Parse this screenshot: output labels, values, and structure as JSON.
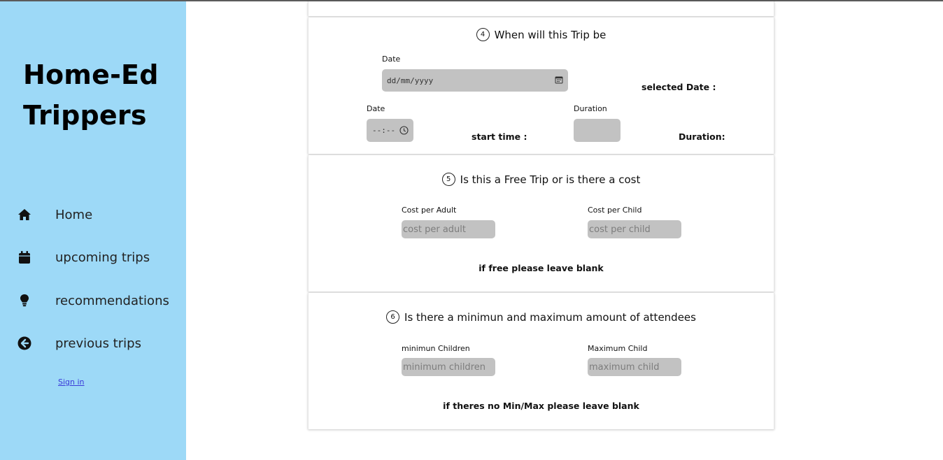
{
  "app": {
    "title_line1": "Home-Ed",
    "title_line2": "Trippers"
  },
  "sidebar": {
    "items": [
      {
        "label": "Home",
        "icon": "home-icon"
      },
      {
        "label": "upcoming trips",
        "icon": "calendar-icon"
      },
      {
        "label": "recommendations",
        "icon": "lightbulb-icon"
      },
      {
        "label": "previous trips",
        "icon": "arrow-left-circle-icon"
      }
    ],
    "signin": "Sign in"
  },
  "steps": {
    "when": {
      "number": "4",
      "title": "When will this Trip be",
      "date_label": "Date",
      "date_placeholder": "dd/mm/yyyy",
      "selected_date": "selected Date :",
      "time_label": "Date",
      "time_placeholder": "--:--",
      "start_time": "start time :",
      "duration_label": "Duration",
      "duration_text": "Duration:"
    },
    "cost": {
      "number": "5",
      "title": "Is this a Free Trip or is there a cost",
      "adult_label": "Cost per Adult",
      "adult_placeholder": "cost per adult",
      "child_label": "Cost per Child",
      "child_placeholder": "cost per child",
      "note": "if free please leave blank"
    },
    "attendees": {
      "number": "6",
      "title": "Is there a minimun and maximum amount of attendees",
      "min_label": "minimun Children",
      "min_placeholder": "minimum children",
      "max_label": "Maximum Child",
      "max_placeholder": "maximum child",
      "note": "if theres no Min/Max please leave blank"
    }
  },
  "colors": {
    "sidebar_bg": "#9dd9f7",
    "field_bg": "#c2c2c2"
  }
}
